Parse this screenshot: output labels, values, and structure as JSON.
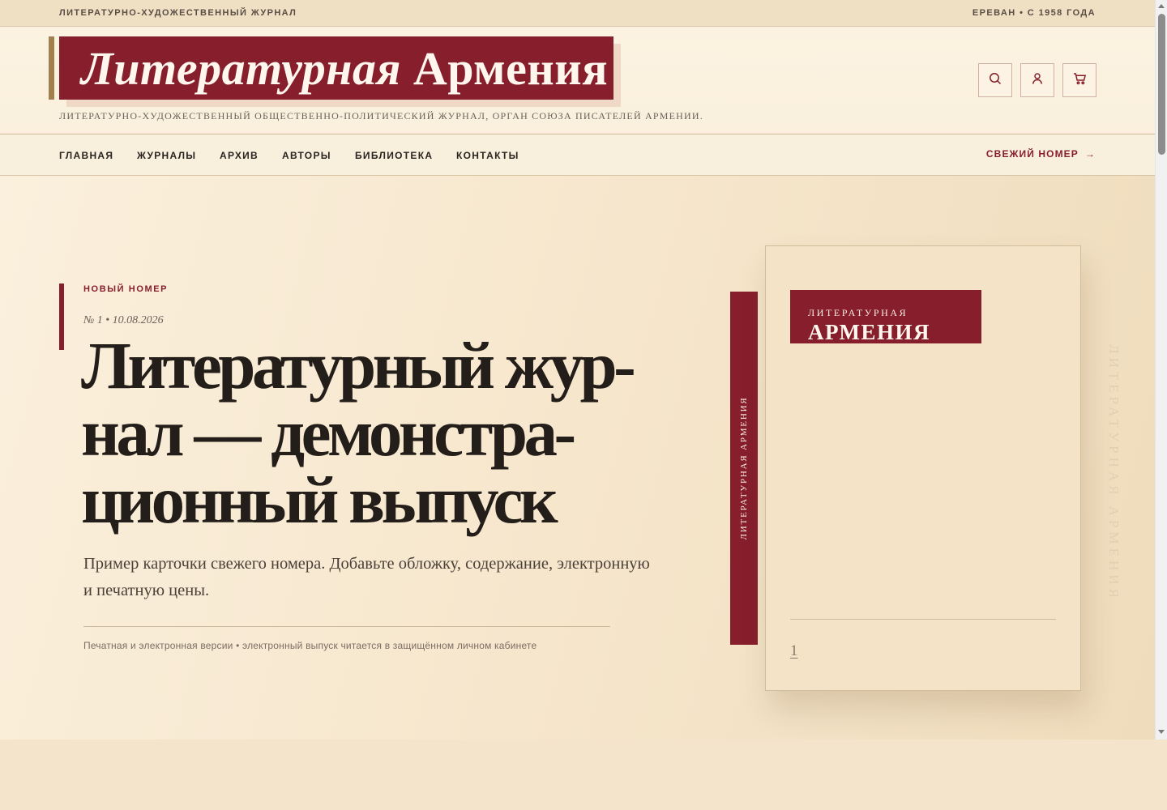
{
  "topbar": {
    "left": "ЛИТЕРАТУРНО-ХУДОЖЕСТВЕННЫЙ ЖУРНАЛ",
    "right": "ЕРЕВАН • С 1958 ГОДА"
  },
  "header": {
    "logo_italic": "Литературная",
    "logo_upright": "Армения",
    "tagline": "ЛИТЕРАТУРНО-ХУДОЖЕСТВЕННЫЙ ОБЩЕСТВЕННО-ПОЛИТИЧЕСКИЙ ЖУРНАЛ, ОРГАН СОЮЗА ПИСАТЕЛЕЙ АРМЕНИИ.",
    "icons": [
      "search-icon",
      "user-icon",
      "cart-icon"
    ]
  },
  "nav": {
    "items": [
      "ГЛАВНАЯ",
      "ЖУРНАЛЫ",
      "АРХИВ",
      "АВТОРЫ",
      "БИБЛИОТЕКА",
      "КОНТАКТЫ"
    ],
    "cta": "СВЕЖИЙ НОМЕР",
    "cta_arrow": "→"
  },
  "hero": {
    "kicker": "НОВЫЙ НОМЕР",
    "issue_meta": "№ 1 • 10.08.2026",
    "title_lines": [
      "Литературный жур-",
      "нал — демонстра-",
      "ционный выпуск"
    ],
    "description": "Пример карточки свежего номера. Добавьте обложку, содержание, электронную и печатную цены.",
    "note": "Печатная и электронная версии • электронный выпуск читается в защищённом личном кабинете"
  },
  "book": {
    "spine_text": "ЛИТЕРАТУРНАЯ АРМЕНИЯ",
    "cover_small": "ЛИТЕРАТУРНАЯ",
    "cover_big": "АРМЕНИЯ",
    "issue_number": "1",
    "watermark": "ЛИТЕРАТУРНАЯ АРМЕНИЯ"
  },
  "colors": {
    "brand": "#861e2c",
    "accent": "#a0804f",
    "background": "#f3e4cb"
  }
}
